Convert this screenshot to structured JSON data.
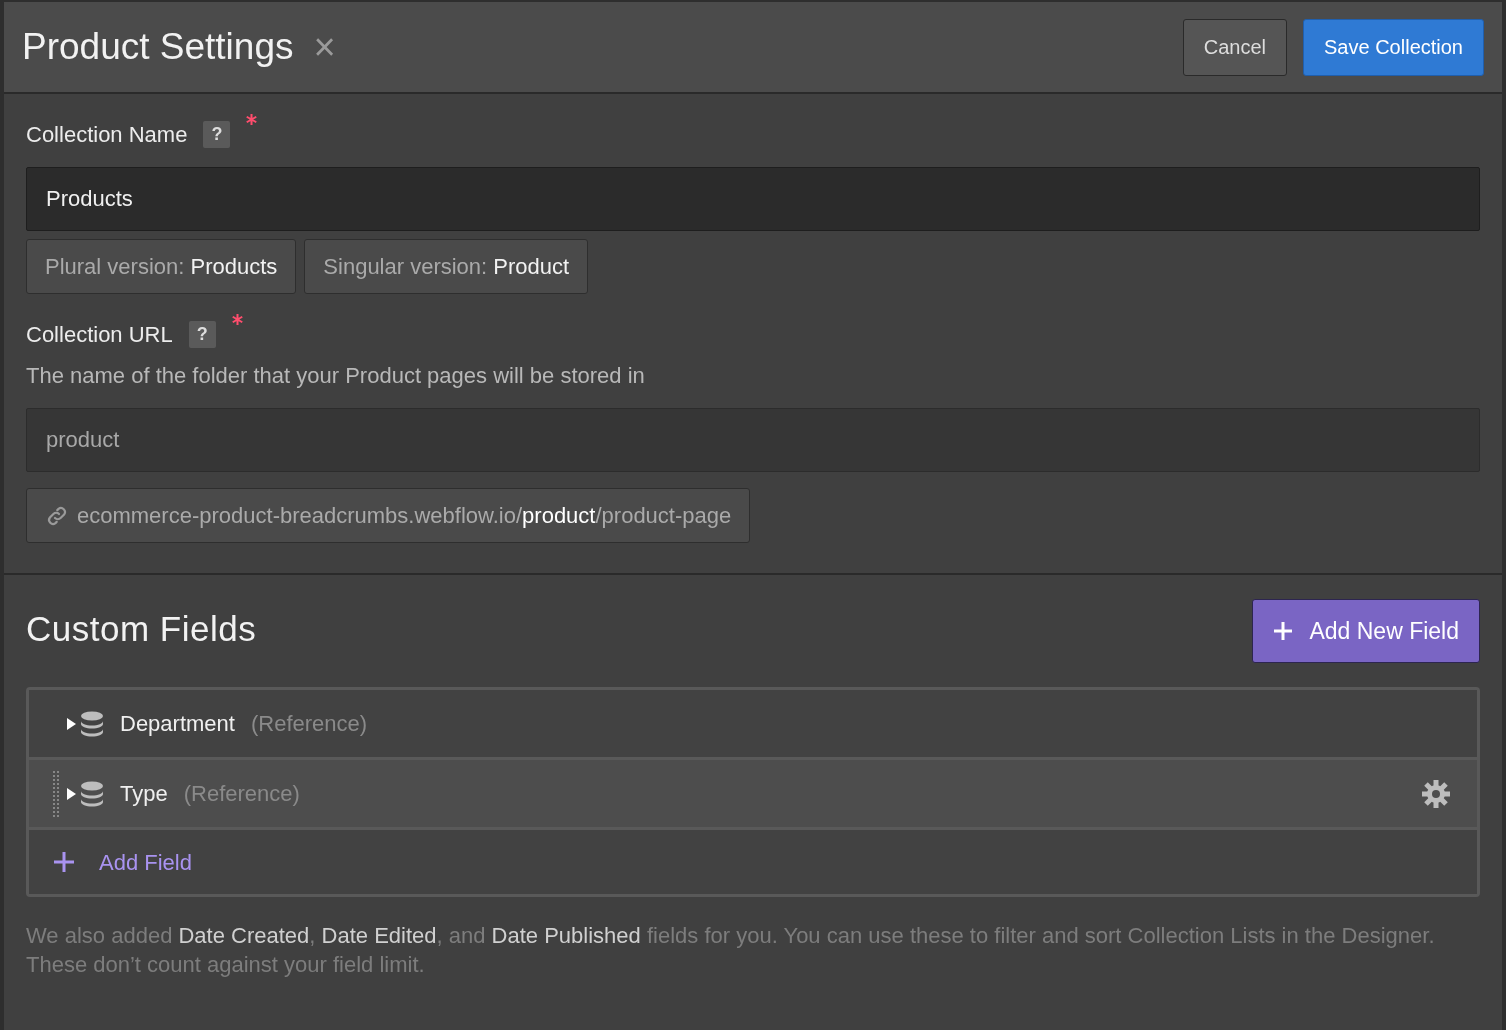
{
  "header": {
    "title": "Product Settings",
    "close": "×",
    "buttons": [
      {
        "label": "Cancel",
        "kind": "secondary"
      },
      {
        "label": "Save Collection",
        "kind": "primary"
      }
    ]
  },
  "collection_name": {
    "label": "Collection Name",
    "help": "?",
    "required": true,
    "value": "Products",
    "versions": [
      {
        "label": "Plural version:",
        "value": "Products"
      },
      {
        "label": "Singular version:",
        "value": "Product"
      }
    ]
  },
  "collection_url": {
    "label": "Collection URL",
    "help": "?",
    "required": true,
    "hint": "The name of the folder that your Product pages will be stored in",
    "placeholder": "product",
    "preview": "ecommerce-product-breadcrumbs.webflow.io/**product**/product-page"
  },
  "custom_fields": {
    "title": "Custom Fields",
    "add_button": "Add New Field",
    "fields": [
      {
        "name": "Department",
        "type": "(Reference)",
        "hovered": false
      },
      {
        "name": "Type",
        "type": "(Reference)",
        "hovered": true
      }
    ],
    "add_field": "Add Field",
    "note": "We also added **Date Created**, **Date Edited**, and **Date Published** fields for you. You can use these to filter and sort Collection Lists in the Designer. These don’t count against your field limit."
  }
}
